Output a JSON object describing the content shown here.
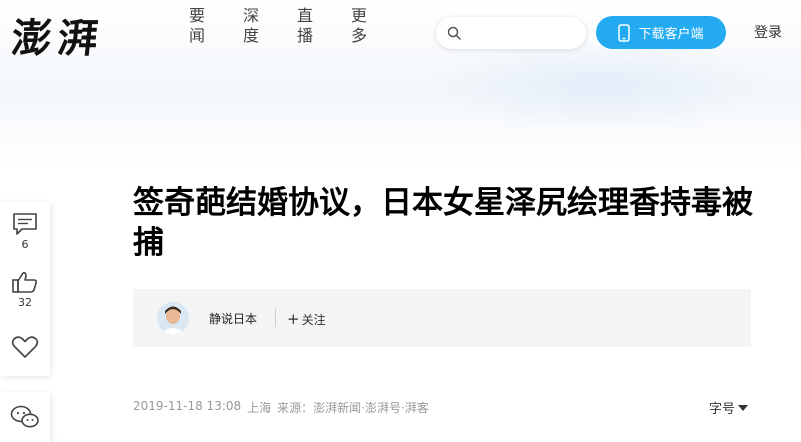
{
  "header": {
    "logo": "澎湃",
    "nav": [
      "要闻",
      "深度",
      "直播",
      "更多"
    ],
    "search_placeholder": "",
    "download_label": "下载客户端",
    "login_label": "登录"
  },
  "article": {
    "title": "签奇葩结婚协议，日本女星泽尻绘理香持毒被捕",
    "author": "静说日本",
    "follow_label": "关注",
    "datetime": "2019-11-18 13:08",
    "location": "上海",
    "source": "来源：澎湃新闻·澎湃号·湃客",
    "font_size_label": "字号"
  },
  "sidebar": {
    "comment_count": "6",
    "like_count": "32"
  },
  "colors": {
    "accent": "#24aaf0",
    "author_bar_bg": "#f4f4f4"
  }
}
